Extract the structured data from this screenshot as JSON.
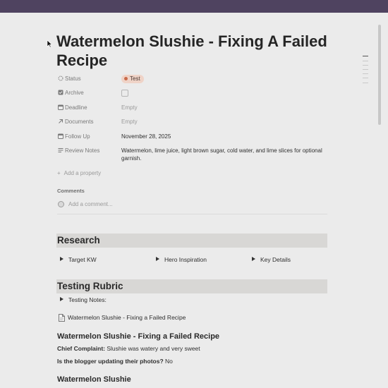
{
  "page": {
    "title": "Watermelon Slushie - Fixing A Failed Recipe"
  },
  "properties": [
    {
      "label": "Status",
      "icon": "status-icon",
      "value": "Test",
      "badge_color": "#efd3c7",
      "dot_color": "#c96a4b"
    },
    {
      "label": "Archive",
      "icon": "checkbox-icon",
      "value": ""
    },
    {
      "label": "Deadline",
      "icon": "calendar-icon",
      "value": "Empty"
    },
    {
      "label": "Documents",
      "icon": "arrow-up-right-icon",
      "value": "Empty"
    },
    {
      "label": "Follow Up",
      "icon": "calendar-icon",
      "value": "November 28, 2025"
    },
    {
      "label": "Review Notes",
      "icon": "text-lines-icon",
      "value": "Watermelon, lime juice, light brown sugar, cold water, and lime slices for optional garnish."
    }
  ],
  "add_property": {
    "label": "Add a property"
  },
  "comments": {
    "title": "Comments",
    "placeholder": "Add a comment..."
  },
  "sections": {
    "research": {
      "heading": "Research",
      "toggles": [
        "Target KW",
        "Hero Inspiration",
        "Key Details"
      ]
    },
    "testing": {
      "heading": "Testing Rubric",
      "toggle": "Testing Notes:",
      "page_link": "Watermelon Slushie - Fixing a Failed Recipe"
    }
  },
  "body": {
    "heading1": "Watermelon Slushie - Fixing a Failed Recipe",
    "complaint_label": "Chief Complaint:",
    "complaint_value": " Slushie was watery and very sweet",
    "blogger_label": "Is the blogger updating their photos?",
    "blogger_value": " No",
    "heading2": "Watermelon Slushie"
  },
  "colors": {
    "topbar": "#4f4360",
    "background": "#ebebeb",
    "heading_block": "#d8d7d5"
  }
}
